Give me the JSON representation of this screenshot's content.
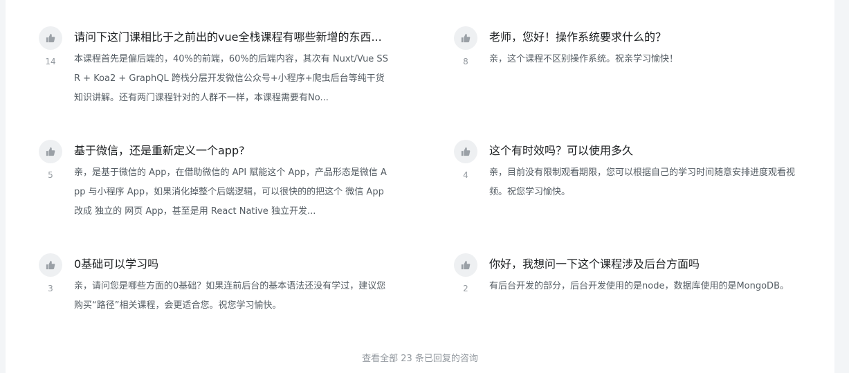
{
  "qa_list": [
    {
      "votes": "14",
      "question": "请问下这门课相比于之前出的vue全栈课程有哪些新增的东西...",
      "answer": "本课程首先是偏后端的，40%的前端，60%的后端内容，其次有 Nuxt/Vue SSR + Koa2 + GraphQL 跨栈分层开发微信公众号+小程序+爬虫后台等纯干货知识讲解。还有两门课程针对的人群不一样，本课程需要有No..."
    },
    {
      "votes": "8",
      "question": "老师，您好！操作系统要求什么的？",
      "answer": "亲，这个课程不区别操作系统。祝亲学习愉快！"
    },
    {
      "votes": "5",
      "question": "基于微信，还是重新定义一个app?",
      "answer": "亲，是基于微信的 App，在借助微信的 API 赋能这个 App，产品形态是微信 App 与小程序 App，如果消化掉整个后端逻辑，可以很快的的把这个 微信 App 改成 独立的 网页 App，甚至是用 React Native 独立开发..."
    },
    {
      "votes": "4",
      "question": "这个有时效吗？可以使用多久",
      "answer": "亲，目前没有限制观看期限，您可以根据自己的学习时间随意安排进度观看视频。祝您学习愉快。"
    },
    {
      "votes": "3",
      "question": "0基础可以学习吗",
      "answer": "亲，请问您是哪些方面的0基础？如果连前后台的基本语法还没有学过，建议您购买“路径”相关课程，会更适合您。祝您学习愉快。"
    },
    {
      "votes": "2",
      "question": "你好，我想问一下这个课程涉及后台方面吗",
      "answer": "有后台开发的部分，后台开发使用的是node，数据库使用的是MongoDB。"
    }
  ],
  "footer": {
    "view_all": "查看全部 23 条已回复的咨询"
  },
  "icons": {
    "vote": "thumbs-up-icon"
  },
  "colors": {
    "background": "#f3f5f7",
    "panel": "#ffffff",
    "question_text": "#1c1f21",
    "answer_text": "#545c63",
    "muted_text": "#93999f",
    "vote_bg": "#eef0f2"
  }
}
